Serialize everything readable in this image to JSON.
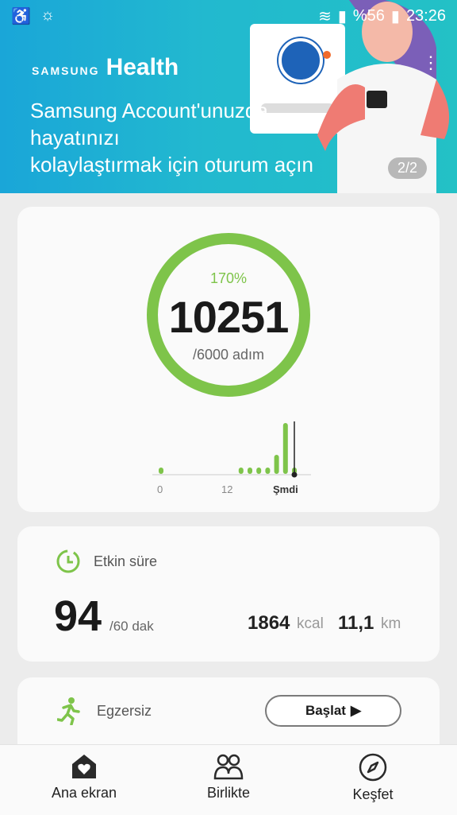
{
  "statusbar": {
    "battery_pct": "%56",
    "time": "23:26"
  },
  "banner": {
    "brand_samsung": "SAMSUNG",
    "brand_health": "Health",
    "headline_line1": "Samsung Account'unuzda",
    "headline_line2": "hayatınızı",
    "headline_line3": "kolaylaştırmak için oturum açın",
    "pager": "2/2"
  },
  "steps": {
    "percent": "170%",
    "count": "10251",
    "goal": "/6000 adım",
    "axis": [
      "0",
      "12",
      "Şmdi"
    ],
    "hourly_values": [
      1,
      0,
      0,
      0,
      0,
      0,
      0,
      0,
      0,
      1,
      1,
      1,
      1,
      3,
      8,
      1
    ]
  },
  "active_time": {
    "label": "Etkin süre",
    "minutes": "94",
    "goal": "/60 dak",
    "kcal_value": "1864",
    "kcal_unit": "kcal",
    "km_value": "11,1",
    "km_unit": "km"
  },
  "exercise": {
    "label": "Egzersiz",
    "start_button": "Başlat"
  },
  "nav": {
    "home": "Ana ekran",
    "together": "Birlikte",
    "discover": "Keşfet"
  },
  "colors": {
    "accent_green": "#7ec44a",
    "banner_blue": "#1aa6d8"
  }
}
